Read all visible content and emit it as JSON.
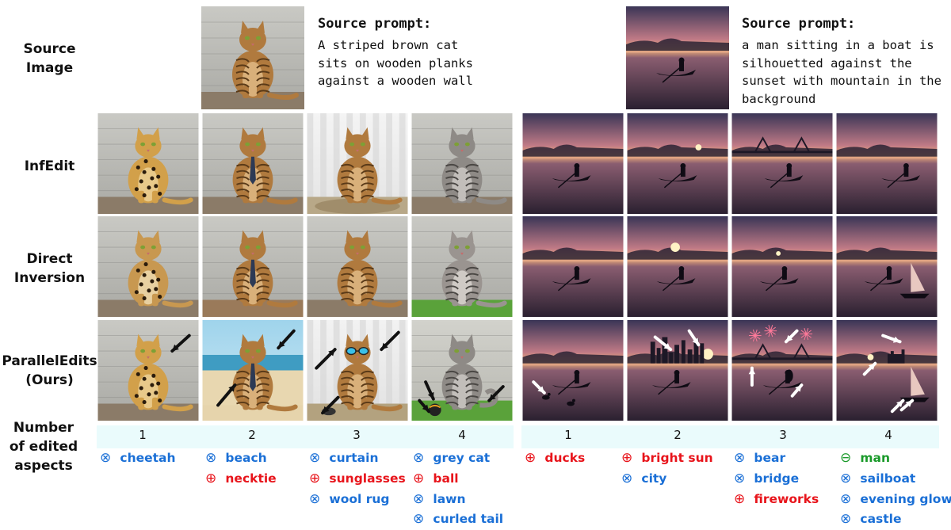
{
  "row_labels": {
    "source": [
      "Source",
      "Image"
    ],
    "infedit": [
      "InfEdit"
    ],
    "direct": [
      "Direct",
      "Inversion"
    ],
    "ours": [
      "ParallelEdits",
      "(Ours)"
    ],
    "number": [
      "Number",
      "of edited",
      "aspects"
    ]
  },
  "left": {
    "prompt_title": "Source prompt:",
    "prompt_lines": [
      "A striped brown cat",
      "sits on wooden planks",
      "against a wooden wall"
    ],
    "numbers": [
      "1",
      "2",
      "3",
      "4"
    ],
    "columns": [
      [
        {
          "sym": "⊗",
          "text": "cheetah",
          "color": "#1a6fd6"
        }
      ],
      [
        {
          "sym": "⊗",
          "text": "beach",
          "color": "#1a6fd6"
        },
        {
          "sym": "⊕",
          "text": "necktie",
          "color": "#e8141b"
        }
      ],
      [
        {
          "sym": "⊗",
          "text": "curtain",
          "color": "#1a6fd6"
        },
        {
          "sym": "⊕",
          "text": "sunglasses",
          "color": "#e8141b"
        },
        {
          "sym": "⊗",
          "text": "wool rug",
          "color": "#1a6fd6"
        }
      ],
      [
        {
          "sym": "⊗",
          "text": "grey cat",
          "color": "#1a6fd6"
        },
        {
          "sym": "⊕",
          "text": "ball",
          "color": "#e8141b"
        },
        {
          "sym": "⊗",
          "text": "lawn",
          "color": "#1a6fd6"
        },
        {
          "sym": "⊗",
          "text": "curled tail",
          "color": "#1a6fd6"
        }
      ]
    ]
  },
  "right": {
    "prompt_title": "Source prompt:",
    "prompt_lines": [
      "a man sitting in a boat is",
      "silhouetted against the",
      "sunset with mountain in the",
      "background"
    ],
    "numbers": [
      "1",
      "2",
      "3",
      "4"
    ],
    "columns": [
      [
        {
          "sym": "⊕",
          "text": "ducks",
          "color": "#e8141b"
        }
      ],
      [
        {
          "sym": "⊕",
          "text": "bright sun",
          "color": "#e8141b"
        },
        {
          "sym": "⊗",
          "text": "city",
          "color": "#1a6fd6"
        }
      ],
      [
        {
          "sym": "⊗",
          "text": "bear",
          "color": "#1a6fd6"
        },
        {
          "sym": "⊗",
          "text": "bridge",
          "color": "#1a6fd6"
        },
        {
          "sym": "⊕",
          "text": "fireworks",
          "color": "#e8141b"
        }
      ],
      [
        {
          "sym": "⊖",
          "text": "man",
          "color": "#1a9a2a"
        },
        {
          "sym": "⊗",
          "text": "sailboat",
          "color": "#1a6fd6"
        },
        {
          "sym": "⊗",
          "text": "evening glow",
          "color": "#1a6fd6"
        },
        {
          "sym": "⊗",
          "text": "castle",
          "color": "#1a6fd6"
        }
      ]
    ]
  },
  "palette": {
    "cat_fur": "#b07a3e",
    "leopard_fur": "#d2a04a",
    "grey_cat": "#8e8a86",
    "wood_wall": "#bdbdb8",
    "beach_sky": "#9fd4ec",
    "curtain": "#ececec",
    "lawn": "#5aa23a",
    "sunset_sky_top": "#3a3556",
    "sunset_sky_mid": "#c07a86",
    "sunset_glow": "#f2b27a",
    "water": "#2a2030"
  }
}
